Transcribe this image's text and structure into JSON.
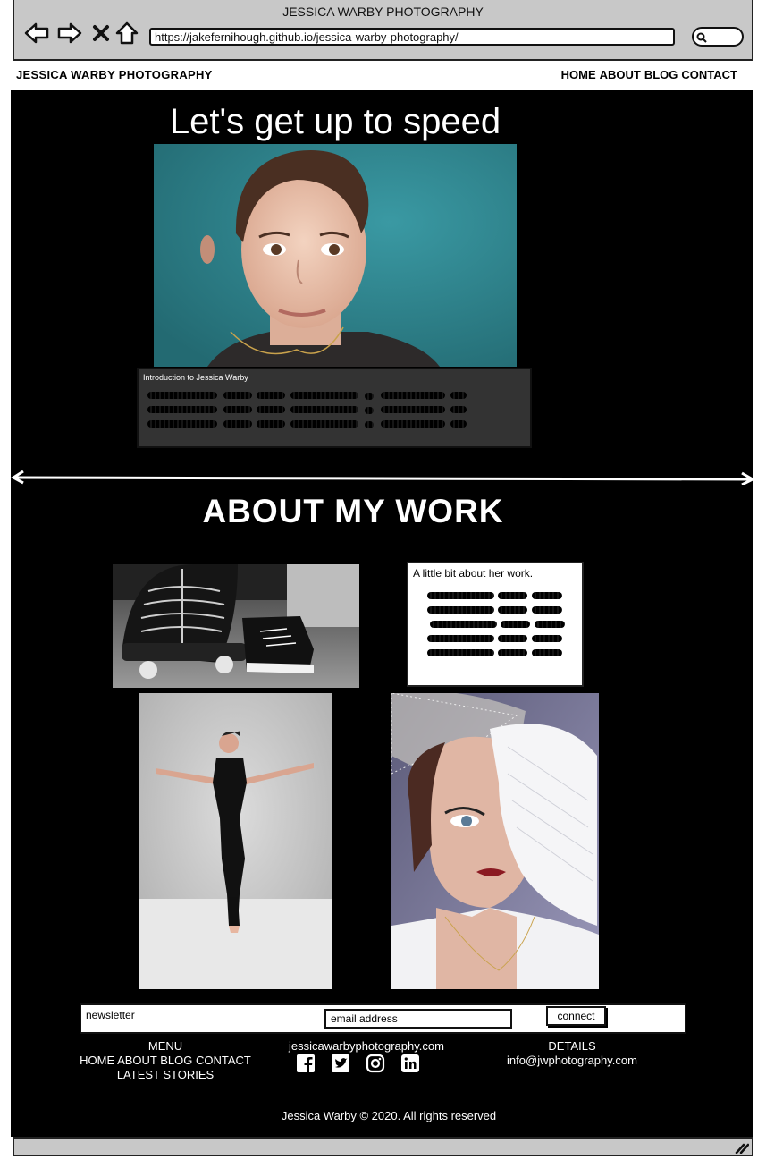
{
  "browser": {
    "window_title": "JESSICA WARBY PHOTOGRAPHY",
    "url": "https://jakefernihough.github.io/jessica-warby-photography/"
  },
  "header": {
    "site_name": "JESSICA WARBY PHOTOGRAPHY",
    "nav": [
      "HOME",
      "ABOUT",
      "BLOG",
      "CONTACT"
    ]
  },
  "hero": {
    "title": "Let's get up to speed",
    "intro_label": "Introduction to Jessica Warby"
  },
  "about": {
    "title": "ABOUT MY WORK",
    "work_label": "A little bit about her work."
  },
  "newsletter": {
    "label": "newsletter",
    "email_placeholder": "email address",
    "button_label": "connect"
  },
  "footer": {
    "menu_heading": "MENU",
    "menu_links": "HOME ABOUT BLOG CONTACT",
    "menu_extra": "LATEST STORIES",
    "site": "jessicawarbyphotography.com",
    "details_heading": "DETAILS",
    "email": "info@jwphotography.com",
    "copyright": "Jessica Warby © 2020. All rights reserved",
    "social_icons": [
      "facebook-icon",
      "twitter-icon",
      "instagram-icon",
      "linkedin-icon"
    ]
  },
  "colors": {
    "page_background": "#000000",
    "chrome": "#c8c8c8",
    "intro_box": "#333333",
    "hero_backdrop": "#2f7f88"
  }
}
